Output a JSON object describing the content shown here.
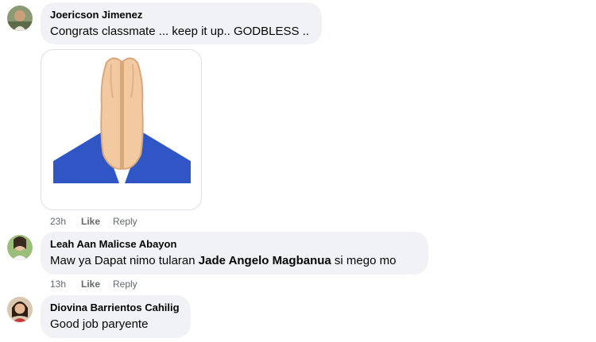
{
  "comments": [
    {
      "author": "Joericson Jimenez",
      "text": "Congrats classmate ... keep it up.. GODBLESS ..",
      "time": "23h",
      "like": "Like",
      "reply": "Reply",
      "sticker": "praying-hands-emoji"
    },
    {
      "author": "Leah Aan Malicse Abayon",
      "text_prefix": "Maw ya Dapat nimo tularan ",
      "mention": "Jade Angelo Magbanua",
      "text_suffix": " si mego mo",
      "time": "13h",
      "like": "Like",
      "reply": "Reply"
    },
    {
      "author": "Diovina Barrientos Cahilig",
      "text": "Good job paryente"
    }
  ],
  "colors": {
    "bubble": "#f0f2f5",
    "meta_text": "#65676b",
    "sleeve": "#2f56c4"
  }
}
